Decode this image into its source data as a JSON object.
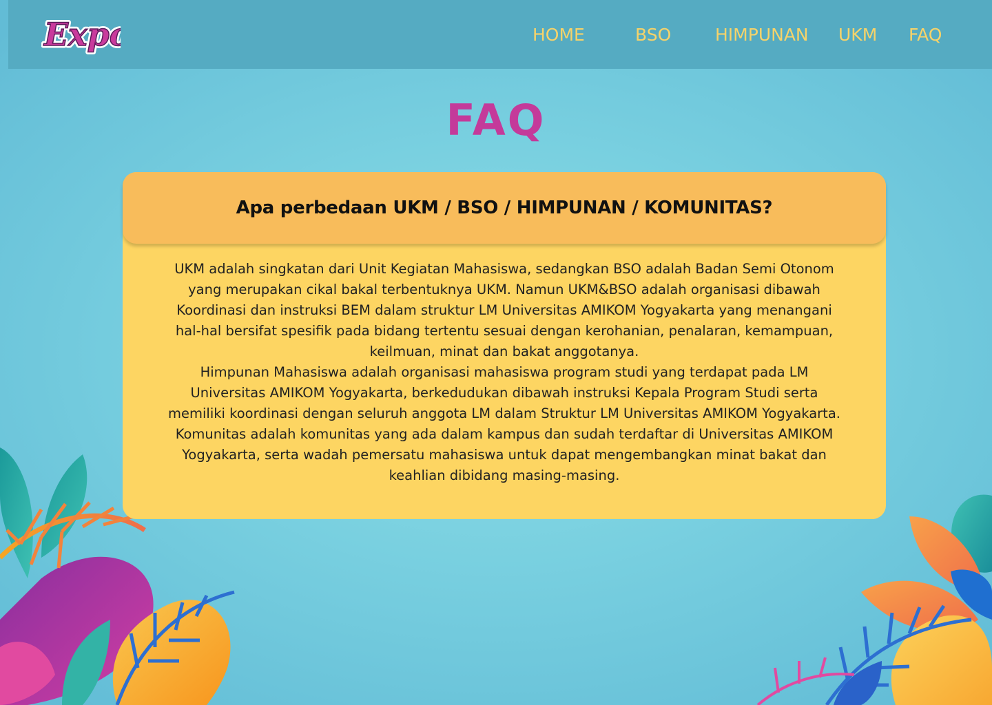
{
  "header": {
    "logo_text": "Expo",
    "nav": [
      {
        "label": "HOME"
      },
      {
        "label": "BSO"
      },
      {
        "label": "HIMPUNAN"
      },
      {
        "label": "UKM"
      },
      {
        "label": "FAQ"
      }
    ]
  },
  "page": {
    "title": "FAQ"
  },
  "faq": {
    "question": "Apa perbedaan UKM / BSO / HIMPUNAN / KOMUNITAS?",
    "answer_paragraphs": [
      "UKM adalah singkatan dari Unit Kegiatan Mahasiswa, sedangkan BSO adalah Badan Semi Otonom yang merupakan cikal bakal terbentuknya UKM. Namun UKM&BSO adalah organisasi dibawah Koordinasi dan instruksi BEM dalam struktur LM Universitas AMIKOM Yogyakarta yang menangani hal-hal bersifat spesifik pada bidang tertentu sesuai dengan kerohanian, penalaran, kemampuan, keilmuan, minat dan bakat anggotanya.",
      "Himpunan Mahasiswa adalah organisasi mahasiswa program studi yang terdapat pada LM Universitas AMIKOM Yogyakarta, berkedudukan dibawah instruksi Kepala Program Studi serta memiliki koordinasi dengan seluruh anggota LM dalam Struktur LM Universitas AMIKOM Yogyakarta.",
      "Komunitas adalah komunitas yang ada dalam kampus dan sudah terdaftar di Universitas AMIKOM Yogyakarta, serta wadah pemersatu mahasiswa untuk dapat mengembangkan minat bakat dan keahlian dibidang masing-masing."
    ]
  },
  "colors": {
    "navbar": "#55abc2",
    "nav_text": "#f6d36a",
    "title": "#c43a9a",
    "card_header": "#f8bc5b",
    "card_body": "#fdd562"
  },
  "icons": {
    "logo": "expo-logo",
    "decoration_left": "tropical-leaves-left",
    "decoration_right": "tropical-leaves-right"
  }
}
